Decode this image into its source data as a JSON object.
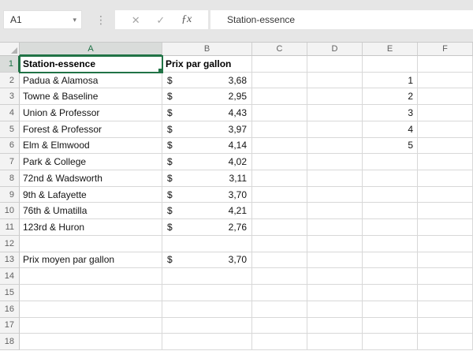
{
  "name_box": {
    "value": "A1"
  },
  "formula_bar": {
    "value": "Station-essence"
  },
  "icons": {
    "dropdown": "▾",
    "cancel": "✕",
    "enter": "✓",
    "function": "ƒx",
    "dots": "⋮"
  },
  "colors": {
    "accent_green": "#217346",
    "topbar_bg": "#e6e6e6",
    "header_bg": "#f3f3f3"
  },
  "grid": {
    "columns": [
      "A",
      "B",
      "C",
      "D",
      "E",
      "F"
    ],
    "selection": {
      "active_cell": "A1",
      "column": "A",
      "row": "1"
    },
    "rows": [
      {
        "n": "1",
        "a": {
          "text": "Station-essence",
          "bold": true
        },
        "b": {
          "text": "Prix par gallon",
          "bold": true
        }
      },
      {
        "n": "2",
        "a": {
          "text": "Padua & Alamosa"
        },
        "b": {
          "sym": "$",
          "val": "3,68"
        },
        "e": "1"
      },
      {
        "n": "3",
        "a": {
          "text": "Towne & Baseline"
        },
        "b": {
          "sym": "$",
          "val": "2,95"
        },
        "e": "2"
      },
      {
        "n": "4",
        "a": {
          "text": "Union & Professor"
        },
        "b": {
          "sym": "$",
          "val": "4,43"
        },
        "e": "3"
      },
      {
        "n": "5",
        "a": {
          "text": "Forest & Professor"
        },
        "b": {
          "sym": "$",
          "val": "3,97"
        },
        "e": "4"
      },
      {
        "n": "6",
        "a": {
          "text": "Elm & Elmwood"
        },
        "b": {
          "sym": "$",
          "val": "4,14"
        },
        "e": "5"
      },
      {
        "n": "7",
        "a": {
          "text": "Park & College"
        },
        "b": {
          "sym": "$",
          "val": "4,02"
        }
      },
      {
        "n": "8",
        "a": {
          "text": "72nd & Wadsworth"
        },
        "b": {
          "sym": "$",
          "val": "3,11"
        }
      },
      {
        "n": "9",
        "a": {
          "text": "9th & Lafayette"
        },
        "b": {
          "sym": "$",
          "val": "3,70"
        }
      },
      {
        "n": "10",
        "a": {
          "text": "76th & Umatilla"
        },
        "b": {
          "sym": "$",
          "val": "4,21"
        }
      },
      {
        "n": "11",
        "a": {
          "text": "123rd & Huron"
        },
        "b": {
          "sym": "$",
          "val": "2,76"
        }
      },
      {
        "n": "12"
      },
      {
        "n": "13",
        "a": {
          "text": "Prix moyen par gallon"
        },
        "b": {
          "sym": "$",
          "val": "3,70"
        }
      },
      {
        "n": "14"
      },
      {
        "n": "15"
      },
      {
        "n": "16"
      },
      {
        "n": "17"
      },
      {
        "n": "18"
      }
    ]
  }
}
